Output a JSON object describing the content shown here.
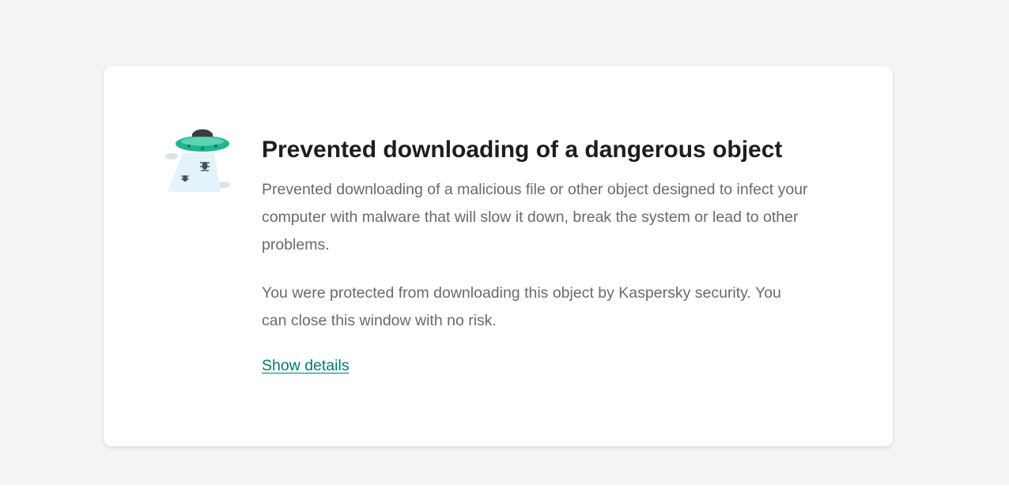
{
  "dialog": {
    "title": "Prevented downloading of a dangerous object",
    "description": "Prevented downloading of a malicious file or other object designed to infect your computer with malware that will slow it down, break the system or lead to other problems.",
    "protection_note": "You were protected from downloading this object by Kaspersky security. You can close this window with no risk.",
    "details_link": "Show details",
    "illustration_icon": "ufo-beam-malware-icon"
  },
  "colors": {
    "page_background": "#f4f4f4",
    "card_background": "#ffffff",
    "title": "#1d1d1b",
    "body_text": "#6a6a6a",
    "link": "#007a6e",
    "ufo_accent": "#1fb58f"
  }
}
